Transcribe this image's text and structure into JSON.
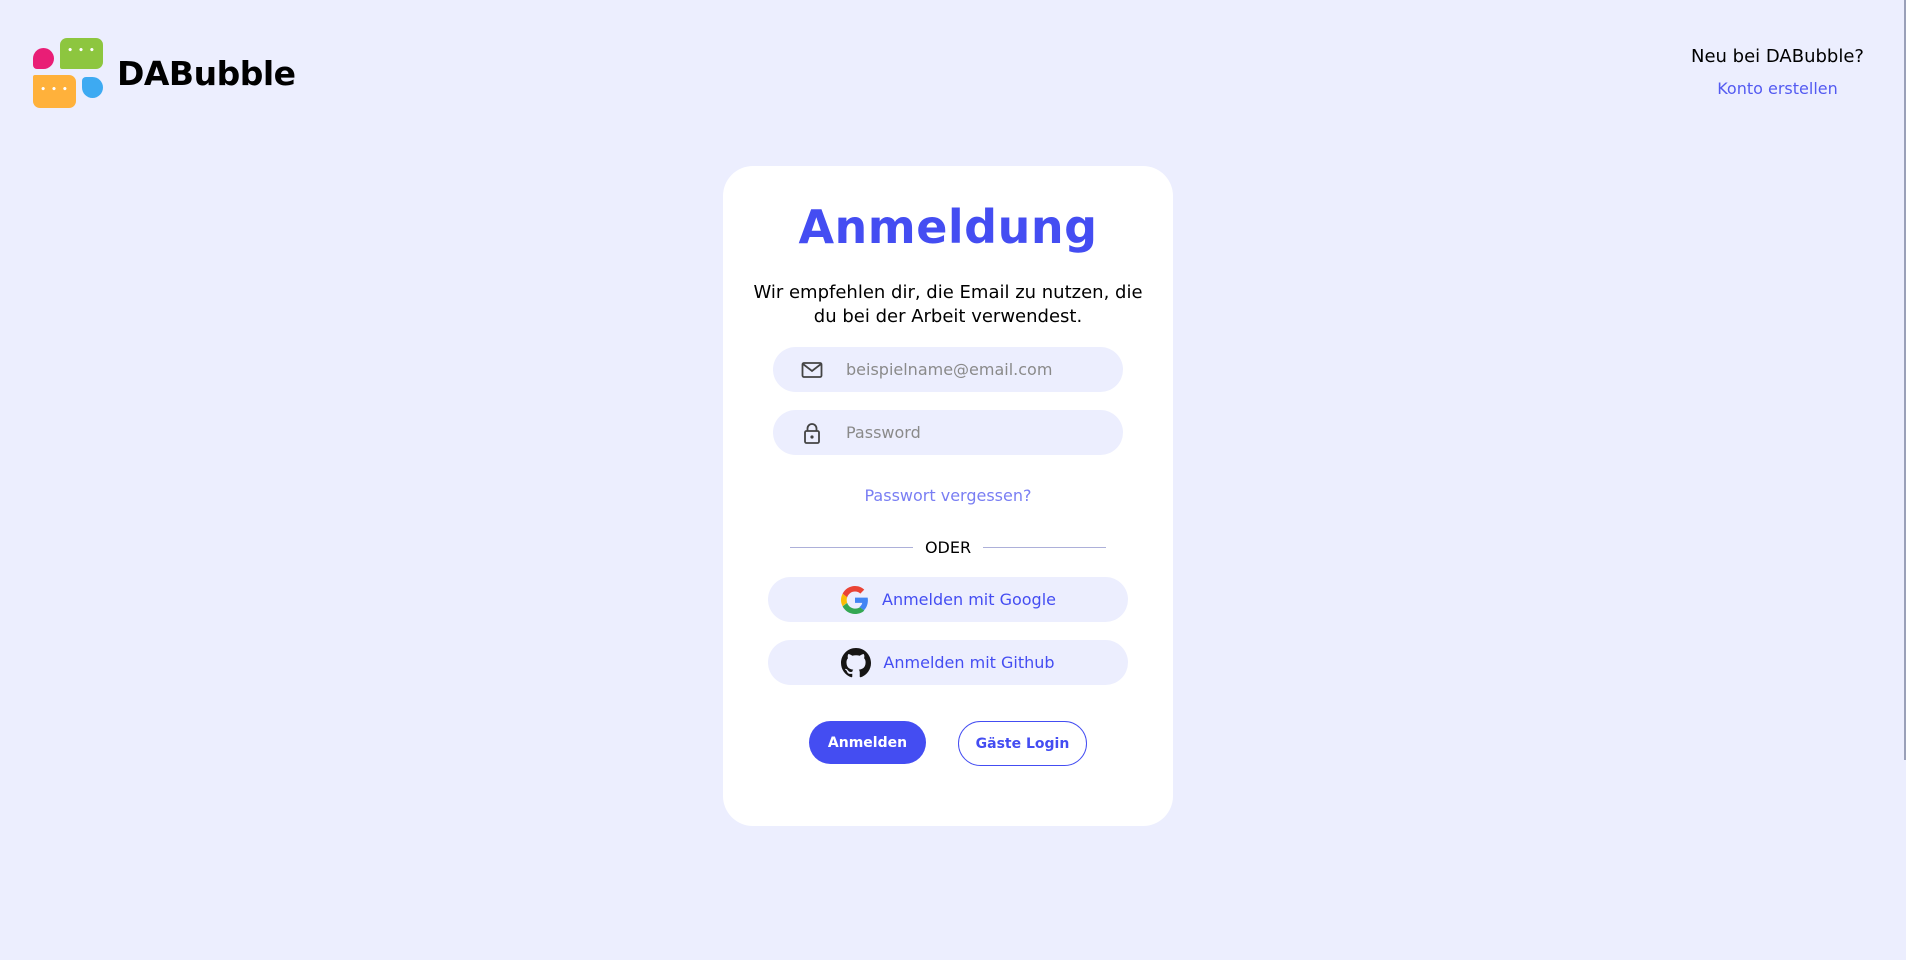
{
  "header": {
    "brand": "DABubble",
    "signup_question": "Neu bei DABubble?",
    "signup_link": "Konto erstellen"
  },
  "login": {
    "title": "Anmeldung",
    "subtitle": "Wir empfehlen dir, die Email zu nutzen, die du bei der Arbeit verwendest.",
    "email": {
      "placeholder": "beispielname@email.com",
      "value": "",
      "icon": "mail-icon"
    },
    "password": {
      "placeholder": "Password",
      "value": "",
      "icon": "lock-icon"
    },
    "forgot_password": "Passwort vergessen?",
    "divider": "ODER",
    "google_button": "Anmelden mit Google",
    "github_button": "Anmelden mit Github",
    "login_button": "Anmelden",
    "guest_button": "Gäste Login"
  },
  "colors": {
    "background": "#eceefe",
    "accent": "#444df2",
    "link": "#535af1",
    "card": "#ffffff"
  }
}
